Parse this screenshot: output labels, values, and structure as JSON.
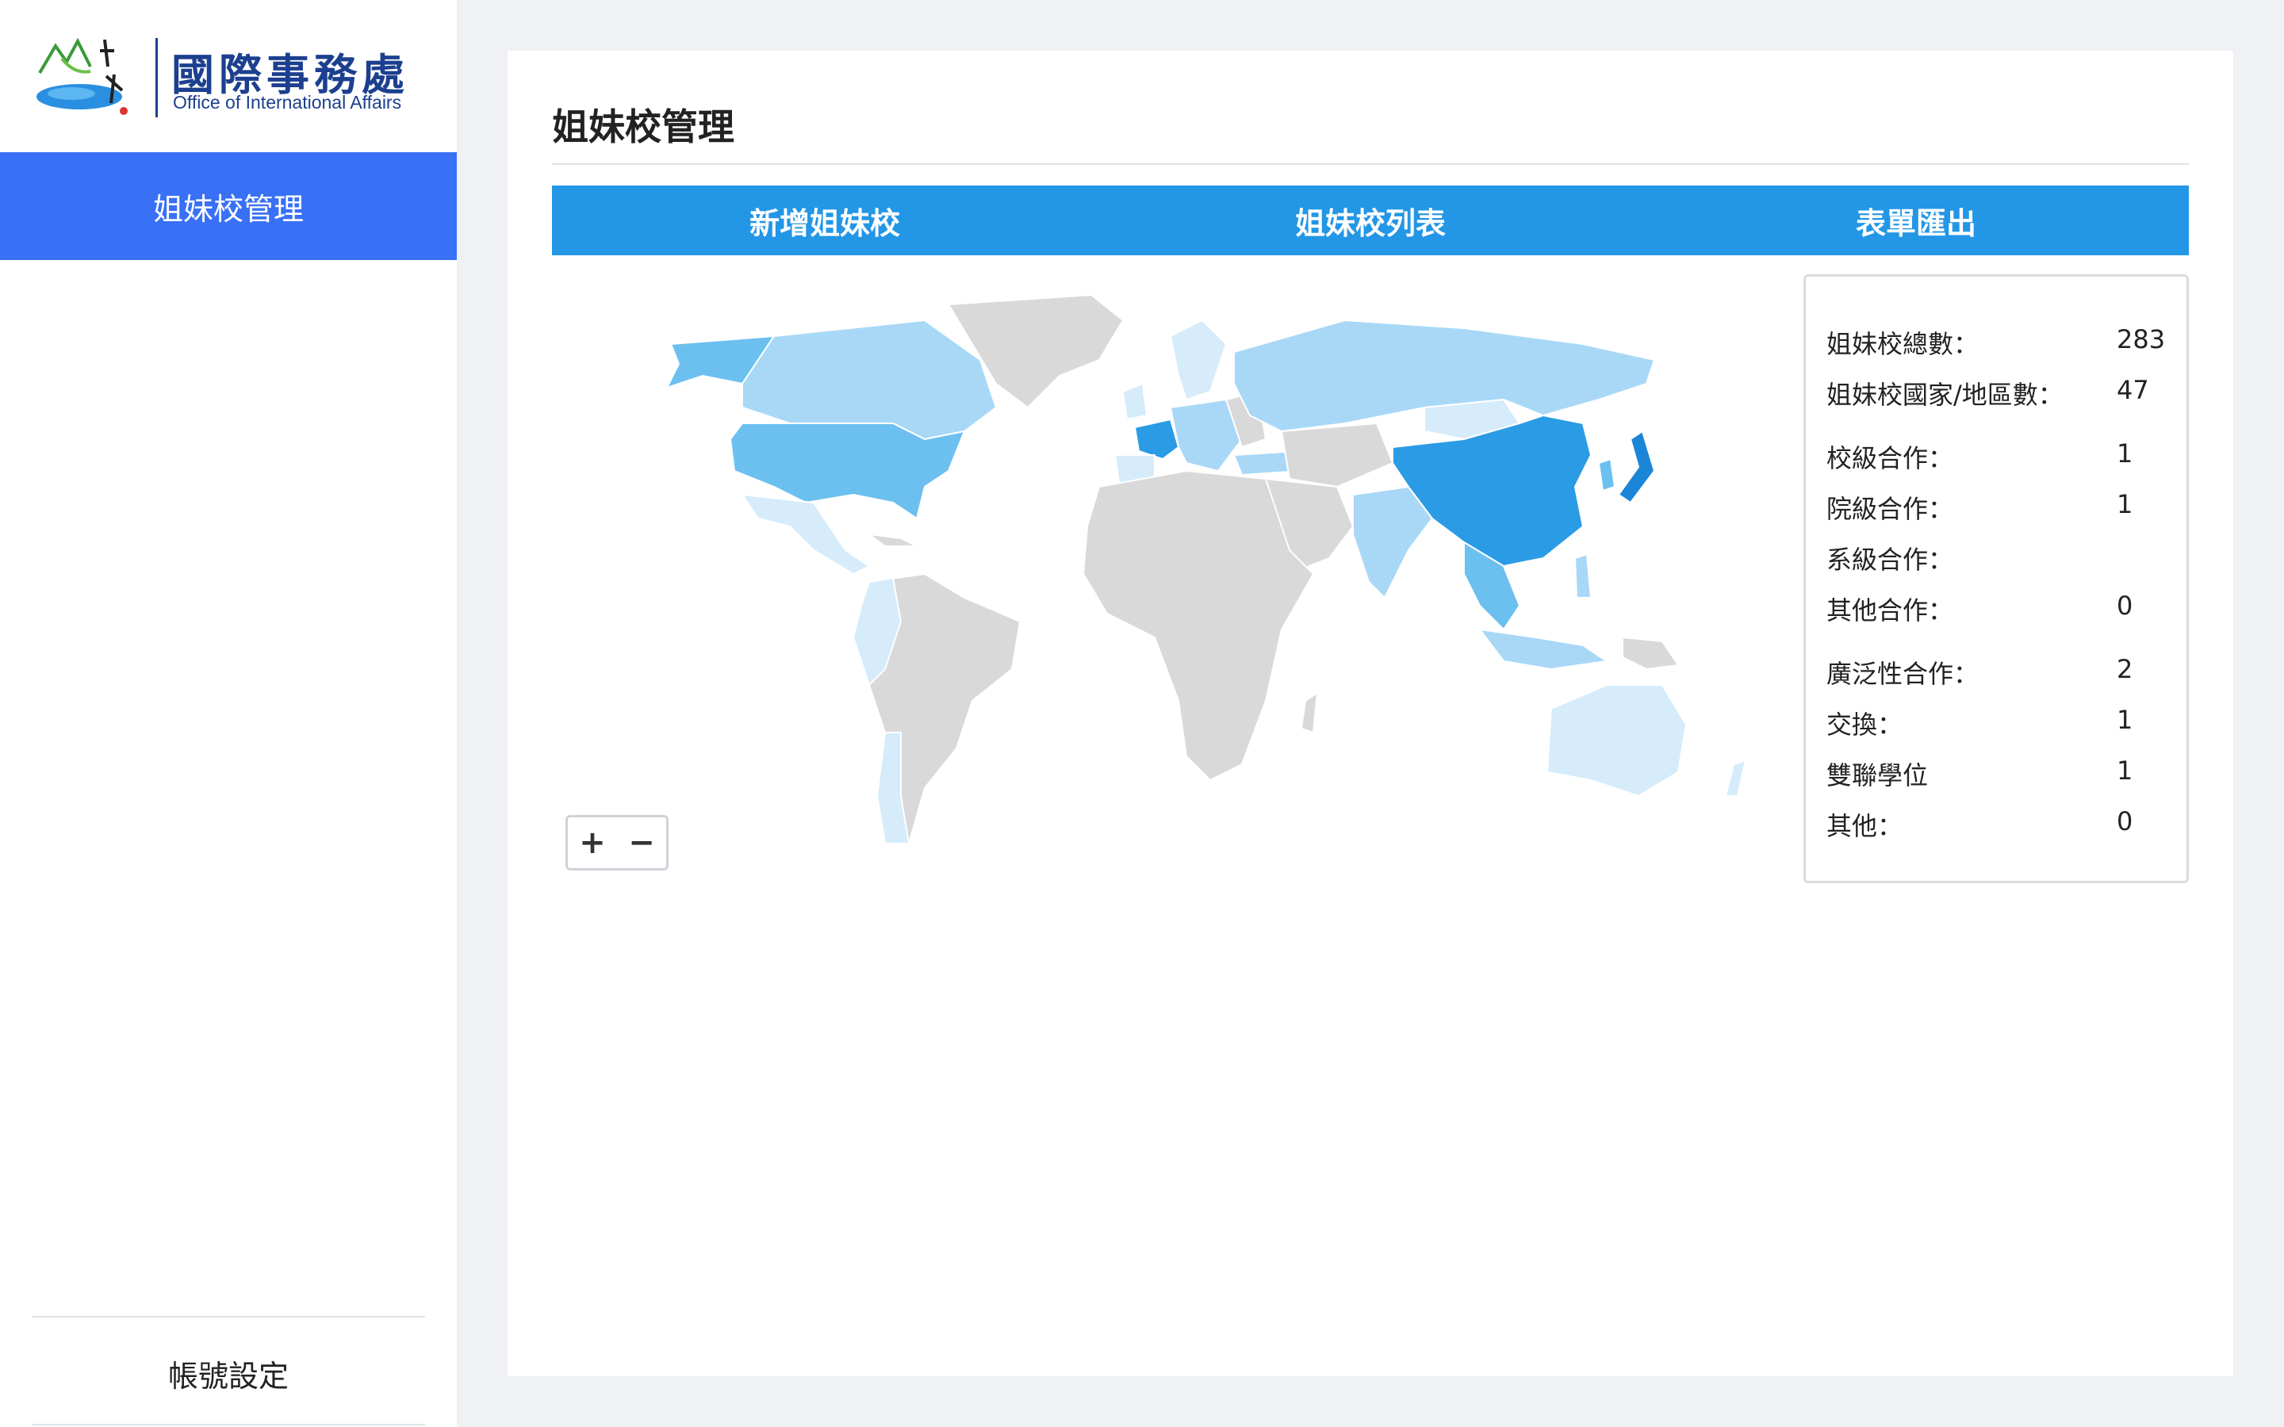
{
  "logo": {
    "title": "國際事務處",
    "subtitle": "Office of International Affairs"
  },
  "sidebar": {
    "items": [
      {
        "label": "姐妹校管理",
        "active": true
      }
    ],
    "account_label": "帳號設定"
  },
  "main": {
    "page_title": "姐妹校管理",
    "tabs": [
      {
        "label": "新增姐妹校"
      },
      {
        "label": "姐妹校列表"
      },
      {
        "label": "表單匯出"
      }
    ]
  },
  "map": {
    "zoom_in": "+",
    "zoom_out": "−",
    "colors": {
      "none": "#d9d9d9",
      "light": "#d6ecfb",
      "mid_light": "#a9d8f7",
      "mid": "#6cc0f0",
      "dark": "#2a9be4",
      "darkest": "#1b85d8"
    }
  },
  "stats": {
    "rows": [
      {
        "label": "姐妹校總數：",
        "value": "283"
      },
      {
        "label": "姐妹校國家/地區數：",
        "value": "47"
      },
      {
        "label": "校級合作：",
        "value": "1"
      },
      {
        "label": "院級合作：",
        "value": "1"
      },
      {
        "label": "系級合作：",
        "value": ""
      },
      {
        "label": "其他合作：",
        "value": "0"
      },
      {
        "label": "廣泛性合作：",
        "value": "2"
      },
      {
        "label": "交換：",
        "value": "1"
      },
      {
        "label": "雙聯學位",
        "value": "1"
      },
      {
        "label": "其他：",
        "value": "0"
      }
    ]
  }
}
